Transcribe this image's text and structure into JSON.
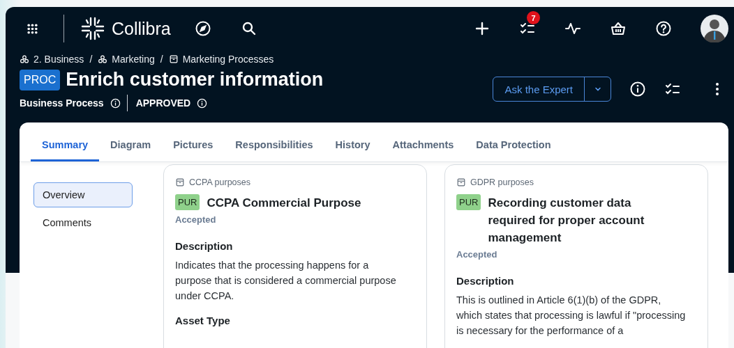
{
  "topbar": {
    "brand": "Collibra",
    "task_count": "7"
  },
  "breadcrumb_separator": "/",
  "breadcrumb": [
    {
      "label": "2. Business",
      "kind": "community"
    },
    {
      "label": "Marketing",
      "kind": "community"
    },
    {
      "label": "Marketing Processes",
      "kind": "domain"
    }
  ],
  "asset": {
    "badge": "PROC",
    "title": "Enrich customer information",
    "type": "Business Process",
    "status": "APPROVED"
  },
  "actions": {
    "primary": "Ask the Expert"
  },
  "tabs": [
    {
      "label": "Summary",
      "selected": true
    },
    {
      "label": "Diagram",
      "selected": false
    },
    {
      "label": "Pictures",
      "selected": false
    },
    {
      "label": "Responsibilities",
      "selected": false
    },
    {
      "label": "History",
      "selected": false
    },
    {
      "label": "Attachments",
      "selected": false
    },
    {
      "label": "Data Protection",
      "selected": false
    }
  ],
  "side_nav": [
    {
      "label": "Overview",
      "selected": true
    },
    {
      "label": "Comments",
      "selected": false
    }
  ],
  "cards": [
    {
      "domain": "CCPA purposes",
      "badge": "PUR",
      "title": "CCPA Commercial Purpose",
      "status": "Accepted",
      "sections": [
        {
          "heading": "Description",
          "text": "Indicates that the processing happens for a purpose that is considered a commercial purpose under CCPA."
        },
        {
          "heading": "Asset Type"
        }
      ]
    },
    {
      "domain": "GDPR purposes",
      "badge": "PUR",
      "title": "Recording customer data required for proper account management",
      "status": "Accepted",
      "sections": [
        {
          "heading": "Description",
          "text": "This is outlined in Article 6(1)(b) of the GDPR, which states that processing is lawful if \"processing is necessary for the performance of a"
        }
      ]
    }
  ]
}
